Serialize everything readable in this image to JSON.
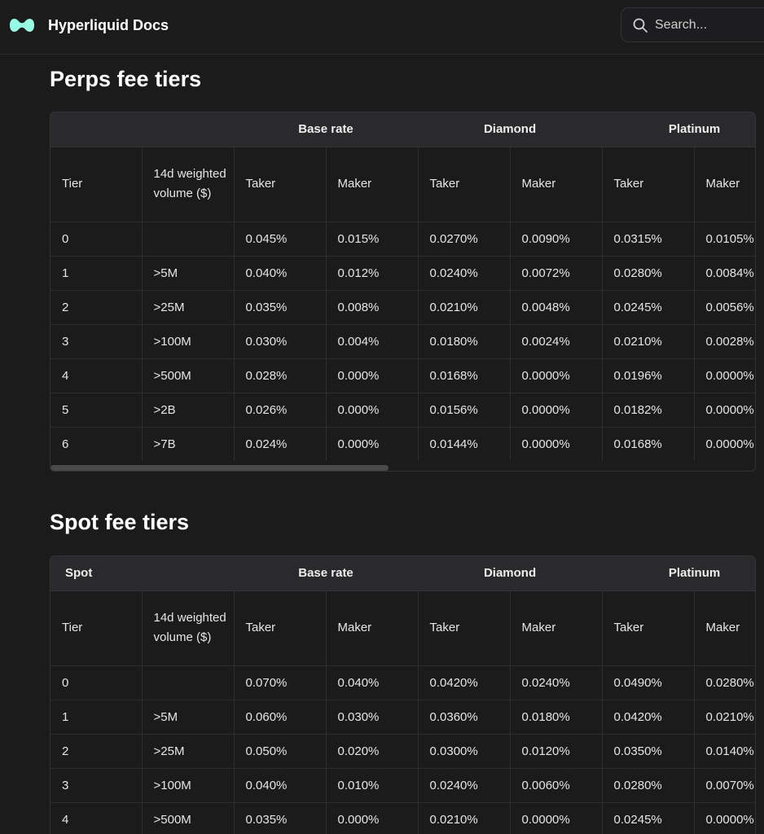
{
  "app": {
    "title": "Hyperliquid Docs",
    "brand_color": "#97fce4"
  },
  "search": {
    "placeholder": "Search..."
  },
  "perps": {
    "title": "Perps fee tiers",
    "group_headers": [
      "",
      "Base rate",
      "Diamond",
      "Platinum"
    ],
    "columns": [
      "Tier",
      "14d weighted volume ($)",
      "Taker",
      "Maker",
      "Taker",
      "Maker",
      "Taker",
      "Maker"
    ],
    "rows": [
      [
        "0",
        "",
        "0.045%",
        "0.015%",
        "0.0270%",
        "0.0090%",
        "0.0315%",
        "0.0105%"
      ],
      [
        "1",
        ">5M",
        "0.040%",
        "0.012%",
        "0.0240%",
        "0.0072%",
        "0.0280%",
        "0.0084%"
      ],
      [
        "2",
        ">25M",
        "0.035%",
        "0.008%",
        "0.0210%",
        "0.0048%",
        "0.0245%",
        "0.0056%"
      ],
      [
        "3",
        ">100M",
        "0.030%",
        "0.004%",
        "0.0180%",
        "0.0024%",
        "0.0210%",
        "0.0028%"
      ],
      [
        "4",
        ">500M",
        "0.028%",
        "0.000%",
        "0.0168%",
        "0.0000%",
        "0.0196%",
        "0.0000%"
      ],
      [
        "5",
        ">2B",
        "0.026%",
        "0.000%",
        "0.0156%",
        "0.0000%",
        "0.0182%",
        "0.0000%"
      ],
      [
        "6",
        ">7B",
        "0.024%",
        "0.000%",
        "0.0144%",
        "0.0000%",
        "0.0168%",
        "0.0000%"
      ]
    ]
  },
  "spot": {
    "title": "Spot fee tiers",
    "group_headers": [
      "Spot",
      "Base rate",
      "Diamond",
      "Platinum"
    ],
    "columns": [
      "Tier",
      "14d weighted volume ($)",
      "Taker",
      "Maker",
      "Taker",
      "Maker",
      "Taker",
      "Maker"
    ],
    "rows": [
      [
        "0",
        "",
        "0.070%",
        "0.040%",
        "0.0420%",
        "0.0240%",
        "0.0490%",
        "0.0280%"
      ],
      [
        "1",
        ">5M",
        "0.060%",
        "0.030%",
        "0.0360%",
        "0.0180%",
        "0.0420%",
        "0.0210%"
      ],
      [
        "2",
        ">25M",
        "0.050%",
        "0.020%",
        "0.0300%",
        "0.0120%",
        "0.0350%",
        "0.0140%"
      ],
      [
        "3",
        ">100M",
        "0.040%",
        "0.010%",
        "0.0240%",
        "0.0060%",
        "0.0280%",
        "0.0070%"
      ],
      [
        "4",
        ">500M",
        "0.035%",
        "0.000%",
        "0.0210%",
        "0.0000%",
        "0.0245%",
        "0.0000%"
      ]
    ]
  }
}
